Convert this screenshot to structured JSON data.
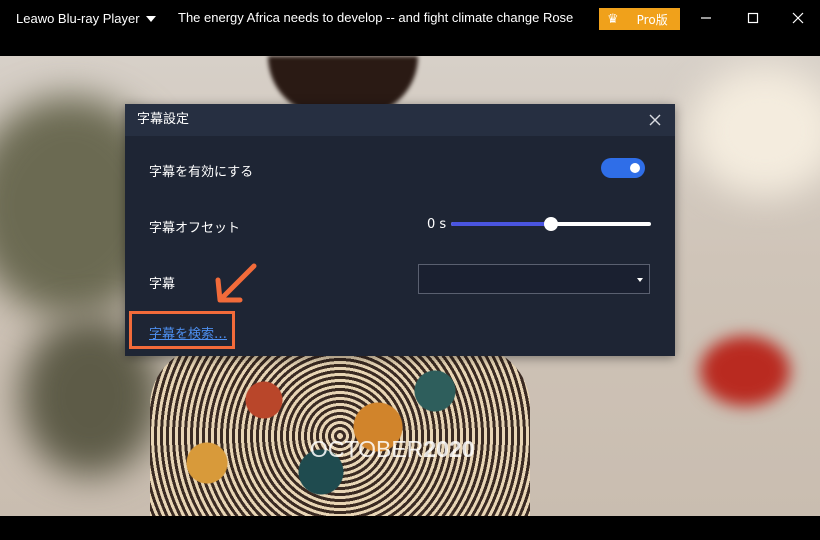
{
  "titlebar": {
    "app_name": "Leawo Blu-ray Player",
    "video_title": "The energy Africa needs to develop -- and fight climate change  Rose",
    "pro_label": "Pro版",
    "minimize_icon": "minimize-icon",
    "maximize_icon": "maximize-icon",
    "close_icon": "close-icon"
  },
  "video": {
    "watermark_light": "OCTOBER",
    "watermark_bold": "2020"
  },
  "dialog": {
    "title": "字幕設定",
    "enable_label": "字幕を有効にする",
    "enable_on": true,
    "offset_label": "字幕オフセット",
    "offset_value": "0 s",
    "offset_level": 0.5,
    "subtitle_label": "字幕",
    "subtitle_selected": "",
    "search_link": "字幕を検索…"
  },
  "colors": {
    "accent": "#2f6ee8",
    "pro": "#f0a11b",
    "highlight": "#f26b3a",
    "link": "#4d8ff0"
  }
}
